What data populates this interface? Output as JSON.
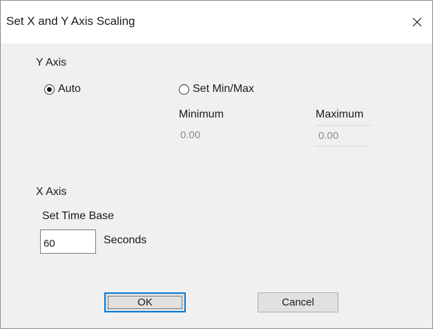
{
  "dialog": {
    "title": "Set X and Y Axis Scaling",
    "close_icon": "close-icon"
  },
  "y_axis": {
    "group_label": "Y Axis",
    "auto_label": "Auto",
    "auto_checked": true,
    "set_minmax_label": "Set Min/Max",
    "set_minmax_checked": false,
    "minimum_label": "Minimum",
    "minimum_value": "0.00",
    "maximum_label": "Maximum",
    "maximum_value": "0.00"
  },
  "x_axis": {
    "group_label": "X Axis",
    "time_base_label": "Set Time Base",
    "time_base_value": "60",
    "units_label": "Seconds"
  },
  "buttons": {
    "ok_label": "OK",
    "cancel_label": "Cancel"
  },
  "colors": {
    "accent": "#0078d7",
    "dialog_background": "#f0f0f0",
    "titlebar_background": "#ffffff",
    "disabled_text": "#8d8d8d"
  }
}
